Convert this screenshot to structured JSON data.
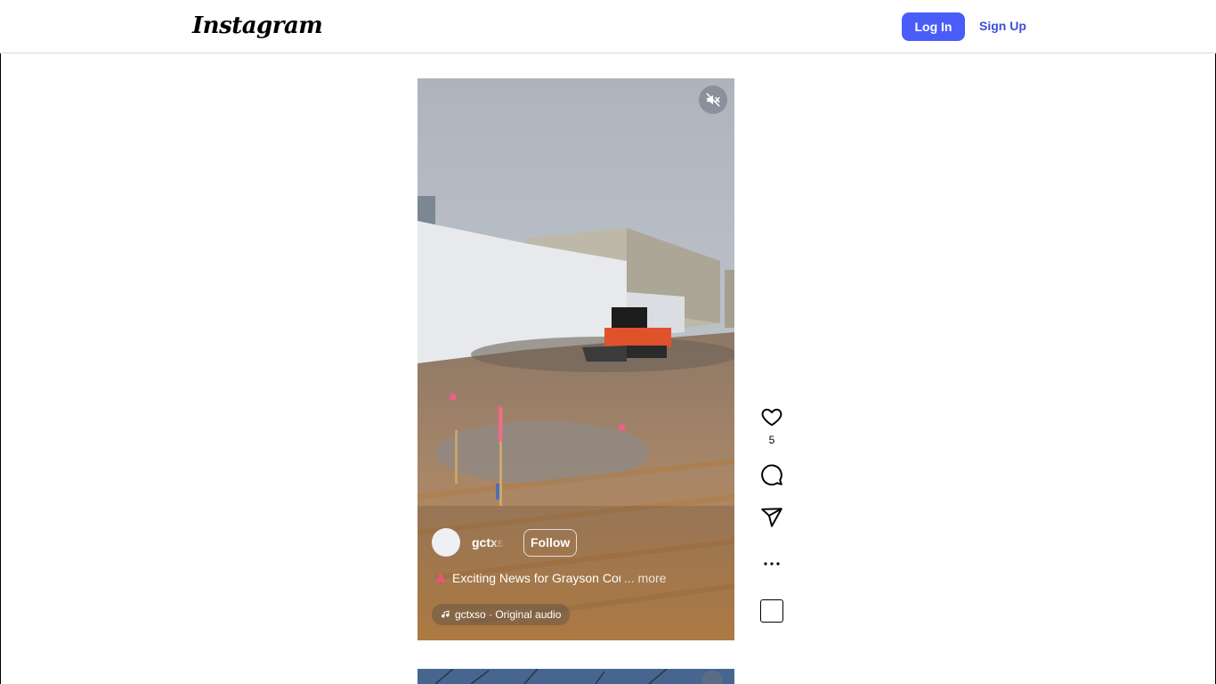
{
  "header": {
    "logo_text": "Instagram",
    "login_label": "Log In",
    "signup_label": "Sign Up",
    "brand_color": "#4a5df9"
  },
  "reel": {
    "muted": true,
    "mute_icon": "speaker-muted-icon",
    "username": "gctxso",
    "follow_label": "Follow",
    "caption_emoji": "christmas-tree-icon",
    "caption_text": "Exciting News for Grayson County!",
    "caption_more": "... more",
    "audio_label": "gctxso · Original audio"
  },
  "actions": {
    "like_count": "5",
    "like_icon": "heart-icon",
    "comment_icon": "comment-icon",
    "share_icon": "send-icon",
    "more_icon": "more-horizontal-icon",
    "audio_thumb_icon": "audio-thumbnail-icon"
  }
}
